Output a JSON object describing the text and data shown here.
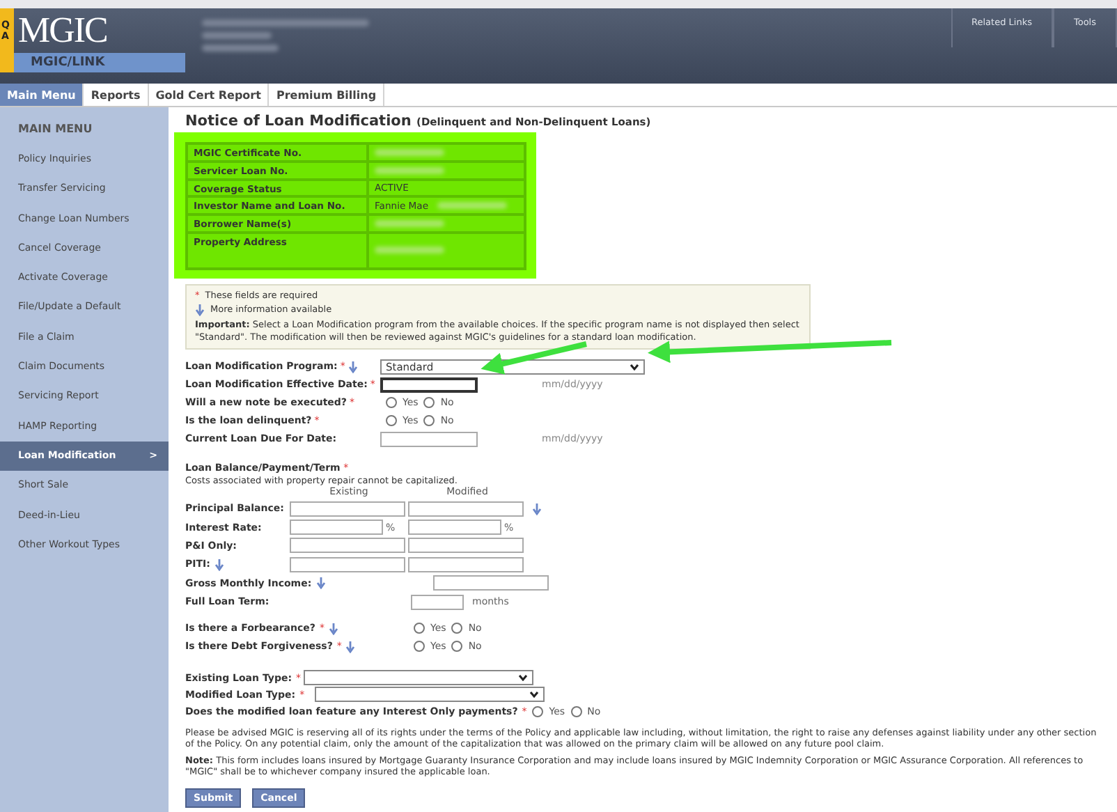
{
  "header": {
    "badge": "QA",
    "logo": "MGIC",
    "product": "MGIC/LINK",
    "links": [
      "Related Links",
      "Tools"
    ]
  },
  "tabs": [
    {
      "label": "Main Menu",
      "selected": true
    },
    {
      "label": "Reports",
      "selected": false
    },
    {
      "label": "Gold Cert Report",
      "selected": false
    },
    {
      "label": "Premium Billing",
      "selected": false
    }
  ],
  "sidebar": {
    "heading": "MAIN MENU",
    "arrow": ">",
    "items": [
      {
        "label": "Policy Inquiries",
        "selected": false
      },
      {
        "label": "Transfer Servicing",
        "selected": false
      },
      {
        "label": "Change Loan Numbers",
        "selected": false
      },
      {
        "label": "Cancel Coverage",
        "selected": false
      },
      {
        "label": "Activate Coverage",
        "selected": false
      },
      {
        "label": "File/Update a Default",
        "selected": false
      },
      {
        "label": "File a Claim",
        "selected": false
      },
      {
        "label": "Claim Documents",
        "selected": false
      },
      {
        "label": "Servicing Report",
        "selected": false
      },
      {
        "label": "HAMP Reporting",
        "selected": false
      },
      {
        "label": "Loan Modification",
        "selected": true
      },
      {
        "label": "Short Sale",
        "selected": false
      },
      {
        "label": "Deed-in-Lieu",
        "selected": false
      },
      {
        "label": "Other Workout Types",
        "selected": false
      }
    ]
  },
  "title": "Notice of Loan Modification",
  "subtitle": "(Delinquent and Non-Delinquent Loans)",
  "summary": [
    {
      "label": "MGIC Certificate No.",
      "blurred": true
    },
    {
      "label": "Servicer Loan No.",
      "blurred": true
    },
    {
      "label": "Coverage Status",
      "value": "ACTIVE",
      "blurred": false
    },
    {
      "label": "Investor Name and Loan No.",
      "value": "Fannie Mae",
      "blurred": true
    },
    {
      "label": "Borrower Name(s)",
      "blurred": true
    },
    {
      "label": "Property Address",
      "blurred": true
    }
  ],
  "legend": {
    "mark": "*",
    "required": "These fields are required",
    "info": "More information available",
    "important": "**Important:**  Select a Loan Modification program from the available choices.  If the specific program name is not displayed then select \"Standard\".  The modification will then be reviewed against MGIC's guidelines for a standard loan modification."
  },
  "fields": [
    {
      "kind": "select",
      "label": "Loan Modification Program:",
      "mark": "*",
      "info": true,
      "value": "Standard"
    },
    {
      "kind": "date",
      "label": "Loan Modification Effective Date:",
      "mark": "*",
      "info": false,
      "hint": "mm/dd/yyyy",
      "focused": true
    },
    {
      "kind": "radio",
      "label": "Will a new note be executed?",
      "mark": "*",
      "info": false,
      "options": [
        {
          "label": "Yes",
          "selected": false
        },
        {
          "label": "No",
          "selected": false
        }
      ]
    },
    {
      "kind": "radio",
      "label": "Is the loan delinquent?",
      "mark": "*",
      "info": false,
      "options": [
        {
          "label": "Yes",
          "selected": false
        },
        {
          "label": "No",
          "selected": false
        }
      ]
    },
    {
      "kind": "date",
      "label": "Current Loan Due For Date:",
      "info": false,
      "hint": "mm/dd/yyyy",
      "focused": false
    }
  ],
  "balance": {
    "title": "Loan Balance/Payment/Term",
    "mark": "*",
    "note": "Costs associated with property repair cannot be capitalized.",
    "columns": [
      "Existing",
      "Modified"
    ],
    "rows": [
      {
        "kind": "pair",
        "label": "Principal Balance:",
        "info": false,
        "after_info": true
      },
      {
        "kind": "pair",
        "label": "Interest Rate:",
        "info": false,
        "unit": "%",
        "after_info": false
      },
      {
        "kind": "pair",
        "label": "P&I Only:",
        "info": false,
        "after_info": false
      },
      {
        "kind": "pair",
        "label": "PITI:",
        "info": true,
        "after_info": false
      },
      {
        "kind": "modified",
        "label": "Gross Monthly Income:",
        "info": true,
        "after_info": false
      },
      {
        "kind": "term",
        "label": "Full Loan Term:",
        "info": false,
        "unit": "months",
        "after_info": false
      }
    ]
  },
  "questions": [
    {
      "label": "Is there a Forbearance?",
      "mark": "*",
      "info": true,
      "options": [
        {
          "label": "Yes",
          "selected": false
        },
        {
          "label": "No",
          "selected": false
        }
      ]
    },
    {
      "label": "Is there Debt Forgiveness?",
      "mark": "*",
      "info": true,
      "options": [
        {
          "label": "Yes",
          "selected": false
        },
        {
          "label": "No",
          "selected": false
        }
      ]
    }
  ],
  "loan_types": [
    {
      "label": "Existing Loan Type:",
      "mark": "*"
    },
    {
      "label": "Modified Loan Type:",
      "mark": "*"
    }
  ],
  "interest_only": {
    "label": "Does the modified loan feature any Interest Only payments?",
    "mark": "*",
    "options": [
      {
        "label": "Yes",
        "selected": false
      },
      {
        "label": "No",
        "selected": false
      }
    ]
  },
  "disclaimer": "Please be advised MGIC is reserving all of its rights under the terms of the Policy and applicable law including, without limitation, the right to raise any defenses against liability under any other section of the Policy.  On any potential claim, only the amount of the capitalization that was allowed on the primary claim will be allowed on any future pool claim.",
  "note": "**Note:**  This form includes loans insured by Mortgage Guaranty Insurance Corporation and may include loans insured by MGIC Indemnity Corporation or MGIC Assurance Corporation.  All references to \"MGIC\" shall be to whichever company insured the applicable loan.",
  "buttons": [
    "Submit",
    "Cancel"
  ]
}
